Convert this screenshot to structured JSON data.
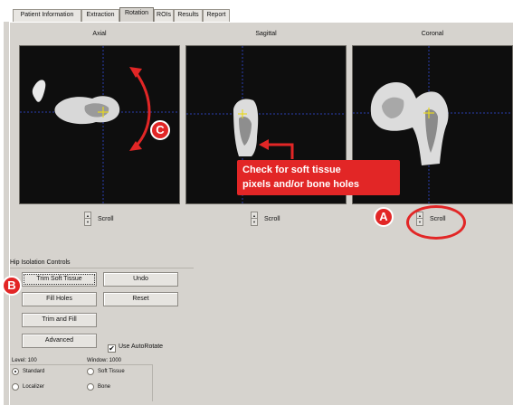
{
  "tabs": [
    {
      "label": "Patient Information",
      "active": false
    },
    {
      "label": "Extraction",
      "active": false
    },
    {
      "label": "Rotation",
      "active": true
    },
    {
      "label": "ROIs",
      "active": false
    },
    {
      "label": "Results",
      "active": false
    },
    {
      "label": "Report",
      "active": false
    }
  ],
  "views": {
    "axial": {
      "title": "Axial",
      "scroll_label": "Scroll"
    },
    "sagittal": {
      "title": "Sagittal",
      "scroll_label": "Scroll"
    },
    "coronal": {
      "title": "Coronal",
      "scroll_label": "Scroll"
    }
  },
  "hip_controls": {
    "group_title": "Hip Isolation Controls",
    "trim_soft_tissue": "Trim Soft Tissue",
    "undo": "Undo",
    "fill_holes": "Fill Holes",
    "reset": "Reset",
    "trim_and_fill": "Trim and Fill",
    "advanced": "Advanced",
    "use_autorotate": "Use AutoRotate",
    "use_autorotate_checked": true
  },
  "window_level": {
    "level_text": "Level:  100",
    "window_text": "Window:  1000",
    "options": [
      {
        "label": "Standard",
        "selected": true
      },
      {
        "label": "Soft Tissue",
        "selected": false
      },
      {
        "label": "Localizer",
        "selected": false
      },
      {
        "label": "Bone",
        "selected": false
      }
    ]
  },
  "annotations": {
    "callout_line1": "Check for soft tissue",
    "callout_line2": "pixels and/or bone holes",
    "badge_a": "A",
    "badge_b": "B",
    "badge_c": "C"
  },
  "colors": {
    "annotation_red": "#e22626",
    "crosshair_blue": "#2a3fb0",
    "crosshair_yellow": "#e8d820",
    "viewport_bg": "#0e0e0e",
    "panel_bg": "#d6d3ce"
  }
}
